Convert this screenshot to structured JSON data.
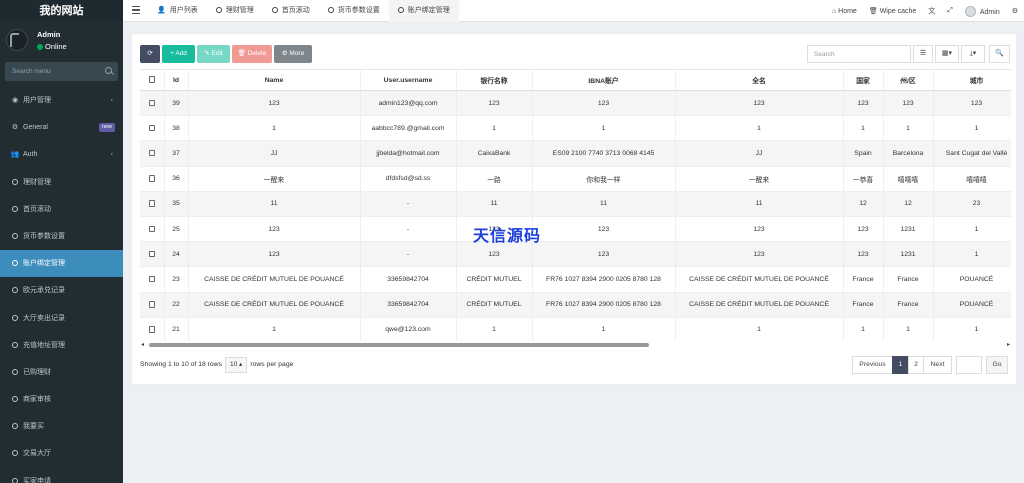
{
  "sidebar": {
    "logo": "我的网站",
    "user": {
      "name": "Admin",
      "status": "Online"
    },
    "search_placeholder": "Search menu",
    "items": [
      {
        "label": "用户管理",
        "icon": "user-circle-icon",
        "chev": "‹"
      },
      {
        "label": "General",
        "icon": "gears-icon",
        "badge": "new"
      },
      {
        "label": "Auth",
        "icon": "group-icon",
        "chev": "‹"
      },
      {
        "label": "理财管理",
        "icon": "circle-icon"
      },
      {
        "label": "首页滚动",
        "icon": "circle-icon"
      },
      {
        "label": "货币参数设置",
        "icon": "circle-icon"
      },
      {
        "label": "账户绑定管理",
        "icon": "circle-icon",
        "active": true
      },
      {
        "label": "欧元承兑记录",
        "icon": "circle-icon"
      },
      {
        "label": "大厅卖出记录",
        "icon": "circle-icon"
      },
      {
        "label": "充值地址管理",
        "icon": "circle-icon"
      },
      {
        "label": "已购理财",
        "icon": "circle-icon"
      },
      {
        "label": "商家审核",
        "icon": "circle-icon"
      },
      {
        "label": "我要买",
        "icon": "circle-icon"
      },
      {
        "label": "交易大厅",
        "icon": "circle-icon"
      },
      {
        "label": "买家申请",
        "icon": "circle-icon"
      }
    ]
  },
  "topbar": {
    "tabs": [
      {
        "label": "用户列表",
        "icon": "user-icon"
      },
      {
        "label": "理财管理",
        "icon": "circle-icon"
      },
      {
        "label": "首页滚动",
        "icon": "circle-icon"
      },
      {
        "label": "货币参数设置",
        "icon": "circle-icon"
      },
      {
        "label": "账户绑定管理",
        "icon": "circle-icon",
        "active": true
      }
    ],
    "home": "Home",
    "wipe_cache": "Wipe cache",
    "admin": "Admin"
  },
  "toolbar": {
    "add": "Add",
    "edit": "Edit",
    "delete": "Delete",
    "more": "More",
    "search_placeholder": "Search"
  },
  "table": {
    "columns": [
      "Id",
      "Name",
      "User.username",
      "银行名称",
      "IBNA账户",
      "全名",
      "国家",
      "州/区",
      "城市"
    ],
    "rows": [
      [
        "39",
        "123",
        "admin123@qq.com",
        "123",
        "123",
        "123",
        "123",
        "123",
        "123"
      ],
      [
        "38",
        "1",
        "aabbcc789.@gmail.com",
        "1",
        "1",
        "1",
        "1",
        "1",
        "1"
      ],
      [
        "37",
        "JJ",
        "jjbelda@hotmail.com",
        "CaixaBank",
        "ES09 2100 7740 3713 0068 4145",
        "JJ",
        "Spain",
        "Barcelona",
        "Sant Cugat del Vallè"
      ],
      [
        "36",
        "一醒来",
        "dfdsfsd@sd.ss",
        "一路",
        "你和我一样",
        "一醒来",
        "一恭喜",
        "嘻嘻嘻",
        "嘻嘻嘻"
      ],
      [
        "35",
        "11",
        "-",
        "11",
        "11",
        "11",
        "12",
        "12",
        "23"
      ],
      [
        "25",
        "123",
        "-",
        "123",
        "123",
        "123",
        "123",
        "1231",
        "1"
      ],
      [
        "24",
        "123",
        "-",
        "123",
        "123",
        "123",
        "123",
        "1231",
        "1"
      ],
      [
        "23",
        "CAISSE DE CRÉDIT MUTUEL DE POUANCÉ",
        "33659842704",
        "CRÉDIT MUTUEL",
        "FR76 1027 8394 2900 0205 8780 128",
        "CAISSE DE CRÉDIT MUTUEL DE POUANCÉ",
        "France",
        "France",
        "POUANCÉ"
      ],
      [
        "22",
        "CAISSE DE CRÉDIT MUTUEL DE POUANCÉ",
        "33659842704",
        "CRÉDIT MUTUEL",
        "FR76 1027 8394 2900 0205 8780 128",
        "CAISSE DE CRÉDIT MUTUEL DE POUANCÉ",
        "France",
        "France",
        "POUANCÉ"
      ],
      [
        "21",
        "1",
        "qwe@123.com",
        "1",
        "1",
        "1",
        "1",
        "1",
        "1"
      ]
    ]
  },
  "footer": {
    "showing": "Showing 1 to 10 of 18 rows",
    "page_size": "10",
    "rows_per_page": "rows per page",
    "previous": "Previous",
    "pages": [
      "1",
      "2"
    ],
    "current_page": "1",
    "next": "Next",
    "go": "Go"
  },
  "watermark": "天信源码",
  "colors": {
    "sidebar_bg": "#222d32",
    "active_menu": "#3c8dbc",
    "add_btn": "#18bc9c",
    "edit_btn": "#77d8c5",
    "delete_btn": "#f09a94",
    "more_btn": "#7e858b",
    "refresh_btn": "#444c63",
    "online": "#00a65a",
    "badge_new": "#605ca8",
    "watermark": "#1b3fd9"
  }
}
